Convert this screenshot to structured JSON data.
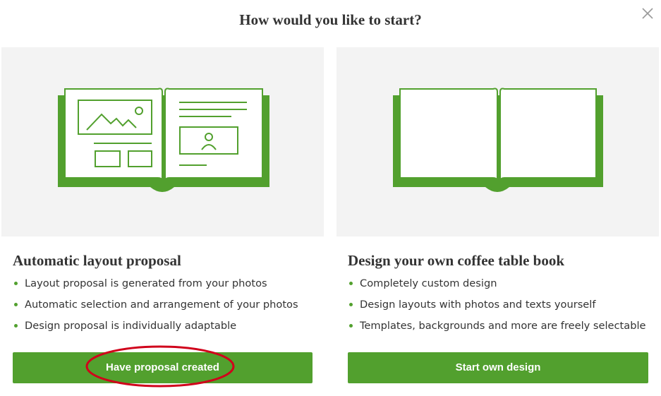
{
  "dialog": {
    "title": "How would you like to start?",
    "close_icon": "close-icon"
  },
  "options": [
    {
      "illustration_icon": "book-with-layout-icon",
      "title": "Automatic layout proposal",
      "features": [
        "Layout proposal is generated from your photos",
        "Automatic selection and arrangement of your photos",
        "Design proposal is individually adaptable"
      ],
      "button_label": "Have proposal created",
      "highlighted": true
    },
    {
      "illustration_icon": "blank-book-icon",
      "title": "Design your own coffee table book",
      "features": [
        "Completely custom design",
        "Design layouts with photos and texts yourself",
        "Templates, backgrounds and more are freely selectable"
      ],
      "button_label": "Start own design",
      "highlighted": false
    }
  ],
  "colors": {
    "accent": "#52a02e",
    "illustration_bg": "#f3f3f3",
    "highlight": "#d0021b",
    "text": "#333333"
  }
}
